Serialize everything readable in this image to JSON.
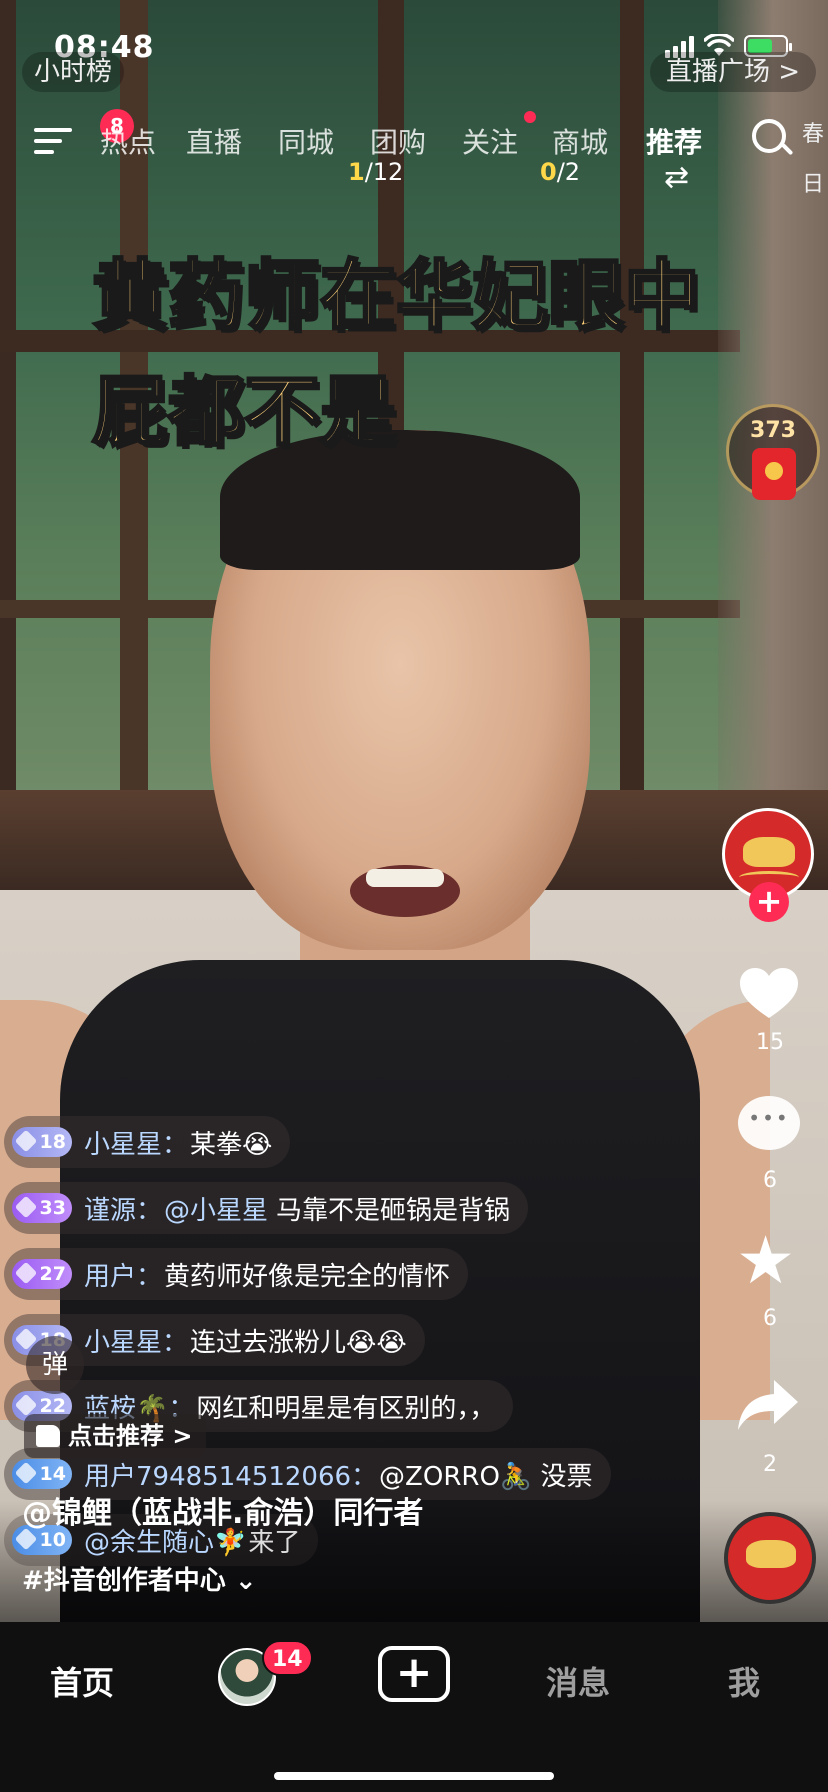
{
  "status": {
    "time": "08:48"
  },
  "top_pills": {
    "left": "小时榜",
    "right": "直播广场 >"
  },
  "nav": {
    "menu_badge": "8",
    "tabs": [
      "热点",
      "直播",
      "同城",
      "团购",
      "关注",
      "商城",
      "推荐"
    ],
    "active_tab": "推荐",
    "counter_a": {
      "current": "1",
      "total": "/12"
    },
    "counter_b": {
      "current": "0",
      "total": "/2"
    },
    "side_strip": [
      "春",
      "日"
    ]
  },
  "caption": {
    "line1": "黄药师在华妃眼中",
    "line2": "屁都不是"
  },
  "red_packet": {
    "count": "373"
  },
  "actions": {
    "likes": "15",
    "comments": "6",
    "favorites": "6",
    "shares": "2"
  },
  "live_comments": [
    {
      "level": "18",
      "user": "小星星：",
      "mention": "",
      "text": "某拳😭",
      "style": "default"
    },
    {
      "level": "33",
      "user": "谨源：",
      "mention": "@小星星",
      "text": "马靠不是砸锅是背锅",
      "style": "purple"
    },
    {
      "level": "27",
      "user": "用户：",
      "mention": "",
      "text": "黄药师好像是完全的情怀",
      "style": "purple"
    },
    {
      "level": "18",
      "user": "小星星：",
      "mention": "",
      "text": "连过去涨粉儿😭😭",
      "style": "default"
    },
    {
      "level": "22",
      "user": "蓝桉🌴：",
      "mention": "",
      "text": "网红和明星是有区别的，，",
      "style": "default"
    },
    {
      "level": "14",
      "user": "用户7948514512066：",
      "mention": "",
      "text": "@ZORRO🚴 没票",
      "style": "blue"
    },
    {
      "level": "10",
      "user": "@余生随心🧚",
      "mention": "",
      "text": "来了",
      "style": "blue"
    }
  ],
  "overlay": {
    "danmu_label": "弹",
    "recommend_label": "点击推荐 >",
    "author": "@锦鲤（蓝战非.俞浩）同行者",
    "tag": "#抖音创作者中心 ⌄"
  },
  "tabbar": {
    "home": "首页",
    "friends_badge": "14",
    "create": "+",
    "messages": "消息",
    "me": "我"
  }
}
